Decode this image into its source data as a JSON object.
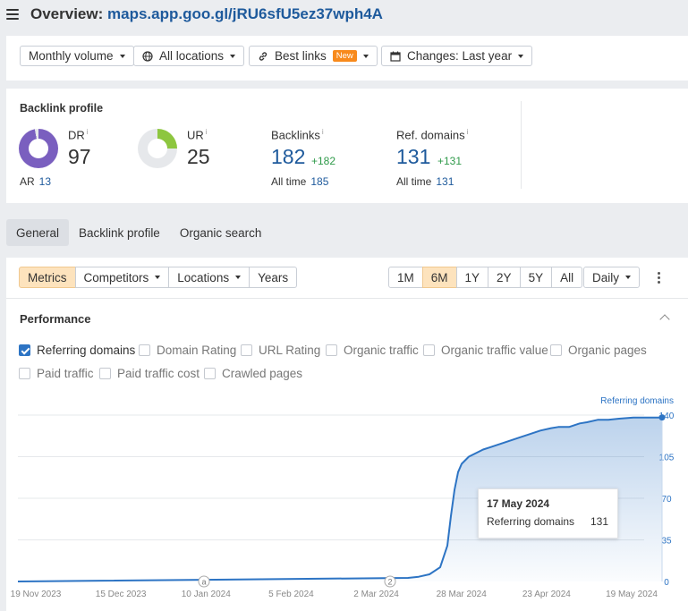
{
  "header": {
    "title_prefix": "Overview: ",
    "url": "maps.app.goo.gl/jRU6sfU5ez37wph4A"
  },
  "filters": {
    "volume": "Monthly volume",
    "locations": "All locations",
    "best_links": "Best links",
    "new_badge": "New",
    "changes": "Changes: Last year"
  },
  "backlink_profile": {
    "heading": "Backlink profile",
    "dr": {
      "label": "DR",
      "info": "i",
      "value": "97",
      "fill_fraction": 0.97,
      "color": "#7a5fbf"
    },
    "ar": {
      "label": "AR",
      "value": "13"
    },
    "ur": {
      "label": "UR",
      "info": "i",
      "value": "25",
      "fill_fraction": 0.25,
      "color": "#8dc63f"
    },
    "backlinks": {
      "label": "Backlinks",
      "info": "i",
      "value": "182",
      "delta": "+182",
      "sub_label": "All time",
      "sub_value": "185"
    },
    "ref_domains": {
      "label": "Ref. domains",
      "info": "i",
      "value": "131",
      "delta": "+131",
      "sub_label": "All time",
      "sub_value": "131"
    }
  },
  "tabs": [
    "General",
    "Backlink profile",
    "Organic search"
  ],
  "toolbar": {
    "metrics": "Metrics",
    "competitors": "Competitors",
    "locations": "Locations",
    "years": "Years",
    "ranges": [
      "1M",
      "6M",
      "1Y",
      "2Y",
      "5Y",
      "All"
    ],
    "active_range": "6M",
    "granularity": "Daily"
  },
  "performance": {
    "heading": "Performance",
    "checkboxes": [
      {
        "label": "Referring domains",
        "checked": true
      },
      {
        "label": "Domain Rating",
        "checked": false
      },
      {
        "label": "URL Rating",
        "checked": false
      },
      {
        "label": "Organic traffic",
        "checked": false
      },
      {
        "label": "Organic traffic value",
        "checked": false
      },
      {
        "label": "Organic pages",
        "checked": false
      },
      {
        "label": "Paid traffic",
        "checked": false
      },
      {
        "label": "Paid traffic cost",
        "checked": false
      },
      {
        "label": "Crawled pages",
        "checked": false
      }
    ]
  },
  "tooltip": {
    "date": "17 May 2024",
    "series": "Referring domains",
    "value": "131"
  },
  "chart_data": {
    "type": "area",
    "title": "",
    "y_axis_label": "Referring domains",
    "x_tick_labels": [
      "19 Nov 2023",
      "15 Dec 2023",
      "10 Jan 2024",
      "5 Feb 2024",
      "2 Mar 2024",
      "28 Mar 2024",
      "23 Apr 2024",
      "19 May 2024"
    ],
    "y_ticks": [
      0,
      35,
      70,
      105,
      140
    ],
    "ylim": [
      0,
      140
    ],
    "xlim": [
      "2023-11-19",
      "2024-05-19"
    ],
    "annotations": [
      {
        "date": "2024-01-10",
        "label": "a"
      },
      {
        "date": "2024-03-02",
        "label": "2"
      }
    ],
    "grid": true,
    "color": "#2d74c4",
    "series": [
      {
        "name": "Referring domains",
        "x": [
          "2023-11-19",
          "2024-03-07",
          "2024-03-10",
          "2024-03-13",
          "2024-03-16",
          "2024-03-18",
          "2024-03-19",
          "2024-03-20",
          "2024-03-21",
          "2024-03-22",
          "2024-03-24",
          "2024-03-26",
          "2024-03-28",
          "2024-03-30",
          "2024-04-02",
          "2024-04-05",
          "2024-04-08",
          "2024-04-10",
          "2024-04-13",
          "2024-04-16",
          "2024-04-18",
          "2024-04-21",
          "2024-04-24",
          "2024-04-26",
          "2024-04-29",
          "2024-05-02",
          "2024-05-05",
          "2024-05-09",
          "2024-05-14",
          "2024-05-17"
        ],
        "y": [
          0,
          3,
          4,
          6,
          12,
          30,
          55,
          77,
          92,
          99,
          105,
          108,
          111,
          113,
          116,
          119,
          122,
          124,
          127,
          129,
          130,
          130,
          133,
          134,
          136,
          136,
          137,
          138,
          138,
          138
        ]
      }
    ]
  }
}
